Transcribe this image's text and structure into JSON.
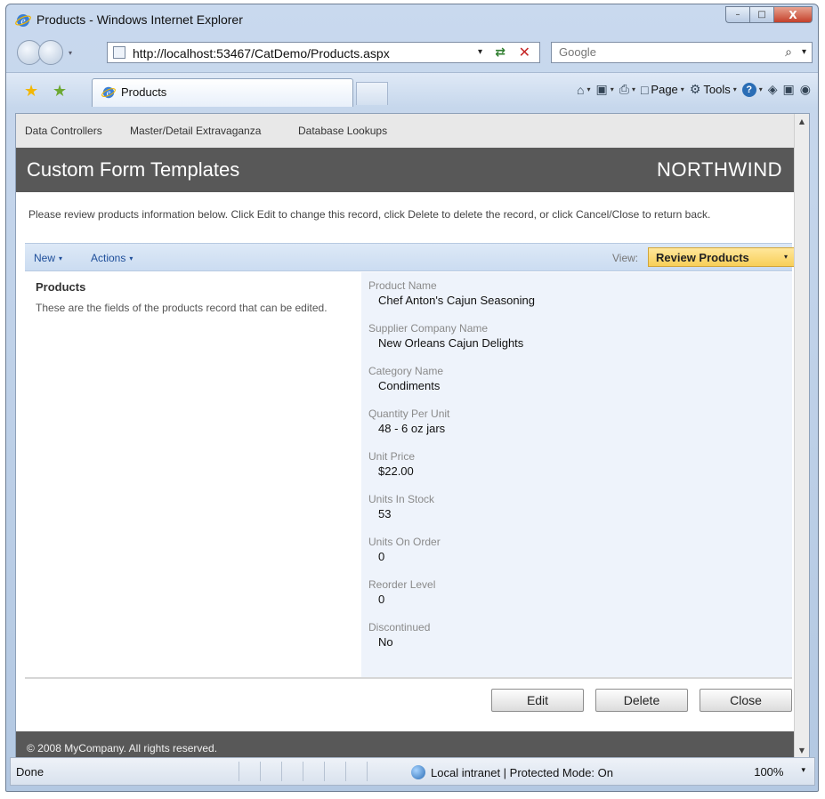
{
  "window": {
    "title": "Products - Windows Internet Explorer",
    "minimize": "–",
    "maximize": "□",
    "close": "X"
  },
  "address": {
    "url": "http://localhost:53467/CatDemo/Products.aspx",
    "drop": "▾",
    "refresh": "⇄",
    "stop": "✕"
  },
  "search": {
    "placeholder": "Google",
    "icon": "⌕",
    "drop": "▾"
  },
  "tabs": {
    "active_label": "Products",
    "fav_star": "★",
    "fav_add": "★"
  },
  "commands": {
    "home": "⌂",
    "feeds": "▣",
    "print": "⎙",
    "page_label": "Page",
    "tools_label": "Tools",
    "help": "?",
    "drop": "▾"
  },
  "site": {
    "menu": [
      "Data Controllers",
      "Master/Detail Extravaganza",
      "Database Lookups"
    ],
    "page_title": "Custom Form Templates",
    "brand": "NORTHWIND",
    "instructions": "Please review products information below. Click Edit to change this record, click Delete to delete the record, or click Cancel/Close to return back.",
    "actions": {
      "new_label": "New",
      "actions_label": "Actions",
      "drop": "▾",
      "view_label": "View:",
      "view_value": "Review Products"
    },
    "category": {
      "title": "Products",
      "description": "These are the fields of the products record that can be edited."
    },
    "fields": [
      {
        "label": "Product Name",
        "value": "Chef Anton's Cajun Seasoning"
      },
      {
        "label": "Supplier Company Name",
        "value": "New Orleans Cajun Delights"
      },
      {
        "label": "Category Name",
        "value": "Condiments"
      },
      {
        "label": "Quantity Per Unit",
        "value": "48 - 6 oz jars"
      },
      {
        "label": "Unit Price",
        "value": "$22.00"
      },
      {
        "label": "Units In Stock",
        "value": "53"
      },
      {
        "label": "Units On Order",
        "value": "0"
      },
      {
        "label": "Reorder Level",
        "value": "0"
      },
      {
        "label": "Discontinued",
        "value": "No"
      }
    ],
    "buttons": {
      "edit": "Edit",
      "delete": "Delete",
      "close": "Close"
    },
    "footer": "© 2008 MyCompany. All rights reserved."
  },
  "scroll": {
    "up": "▲",
    "down": "▼"
  },
  "status": {
    "text": "Done",
    "zone": "Local intranet | Protected Mode: On",
    "zoom": "100%",
    "zoom_drop": "▾"
  },
  "colors": {
    "header_bg": "#585858",
    "action_bar": "#cbdcf1",
    "view_select": "#f8cf58",
    "fields_bg": "#eef3fb"
  }
}
